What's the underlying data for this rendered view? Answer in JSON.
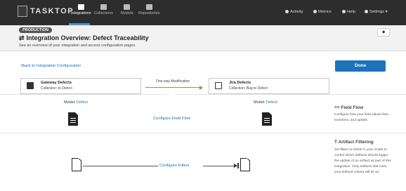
{
  "app": {
    "logo_text": "TASKTOP",
    "nav": [
      {
        "label": "Integrations",
        "icon": "integrations-icon",
        "active": true
      },
      {
        "label": "Collections",
        "icon": "collections-icon",
        "active": false
      },
      {
        "label": "Models",
        "icon": "models-icon",
        "active": false
      },
      {
        "label": "Repositories",
        "icon": "repositories-icon",
        "active": false
      }
    ],
    "right_nav": [
      {
        "label": "Activity",
        "icon": "bell-icon"
      },
      {
        "label": "Metrics",
        "icon": "metrics-icon"
      },
      {
        "label": "Help",
        "icon": "help-icon"
      },
      {
        "label": "Settings",
        "icon": "gear-icon"
      }
    ],
    "settings_caret": "▾"
  },
  "header": {
    "badge": "PRODUCTION",
    "title": "Integration Overview: Defect Traceability",
    "title_icon": "⇄",
    "subtitle": "See an overview of your integration and access configuration pages.",
    "pin_icon": "◆"
  },
  "actions": {
    "back_label": "Back to Integration Configuration",
    "back_icon": "‹",
    "done_label": "Done"
  },
  "flow": {
    "source": {
      "name": "Gateway Defects",
      "collection": "Collection: to Defect"
    },
    "target": {
      "name": "Jira Defects",
      "collection": "Collection: Bug to Defect"
    },
    "direction_label": "One-way Modification"
  },
  "field_flow": {
    "left_model_prefix": "Model: ",
    "left_model": "Defect",
    "right_model_prefix": "Model: ",
    "right_model": "Defect",
    "configure_label": "Configure Field Flow",
    "side_icon": "≡≡",
    "side_title": "Field Flow",
    "side_desc": "Configure how your field values flow, transform, and update."
  },
  "artifact_filtering": {
    "configure_label": "Configure Filters",
    "side_icon": "T",
    "side_title": "Artifact Filtering",
    "side_desc": "Set filters on fields in your model to control which artifacts should trigger the update of an artifact as part of this integration. Only artifacts that meet your defined criteria will do so."
  },
  "colors": {
    "topbar": "#2d2d2d",
    "accent": "#1b73ba",
    "link": "#1a6fb8",
    "flow_arrow": "#6aa84f"
  }
}
